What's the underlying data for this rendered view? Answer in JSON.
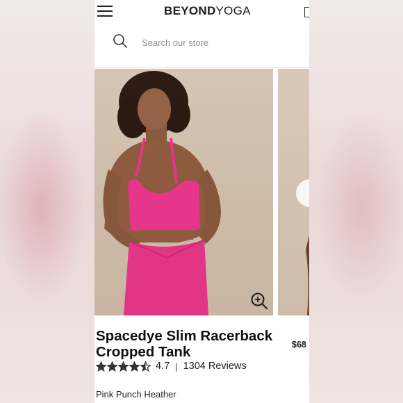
{
  "header": {
    "menu_icon": "hamburger-menu-icon",
    "brand_part1": "BEYOND",
    "brand_part2": "YOGA",
    "bag_icon": "shopping-bag-icon"
  },
  "search": {
    "icon": "search-icon",
    "placeholder": "Search our store"
  },
  "gallery": {
    "main_image": "model wearing pink cropped racerback tank and pink leggings",
    "zoom_icon": "zoom-in-icon"
  },
  "product": {
    "title": "Spacedye Slim Racerback Cropped Tank",
    "price": "$68",
    "rating": {
      "stars_value": 4.7,
      "value_label": "4.7",
      "separator": "|",
      "reviews_label": "1304 Reviews"
    },
    "color": "Pink Punch Heather",
    "accent_color": "#e6358a"
  }
}
